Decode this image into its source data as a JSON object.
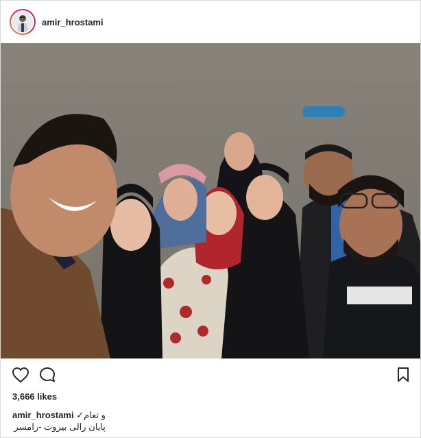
{
  "post": {
    "username": "amir_hrostami",
    "likes_text": "3,666 likes",
    "caption_line1": "و تعام✓",
    "caption_line2": "پایان رالی بیروت -رامسر"
  },
  "icons": {
    "like": "heart-outline-icon",
    "comment": "comment-bubble-icon",
    "save": "bookmark-outline-icon"
  },
  "colors": {
    "text": "#262626",
    "border": "#dbdbdb",
    "story_ring": "#dc2743"
  }
}
